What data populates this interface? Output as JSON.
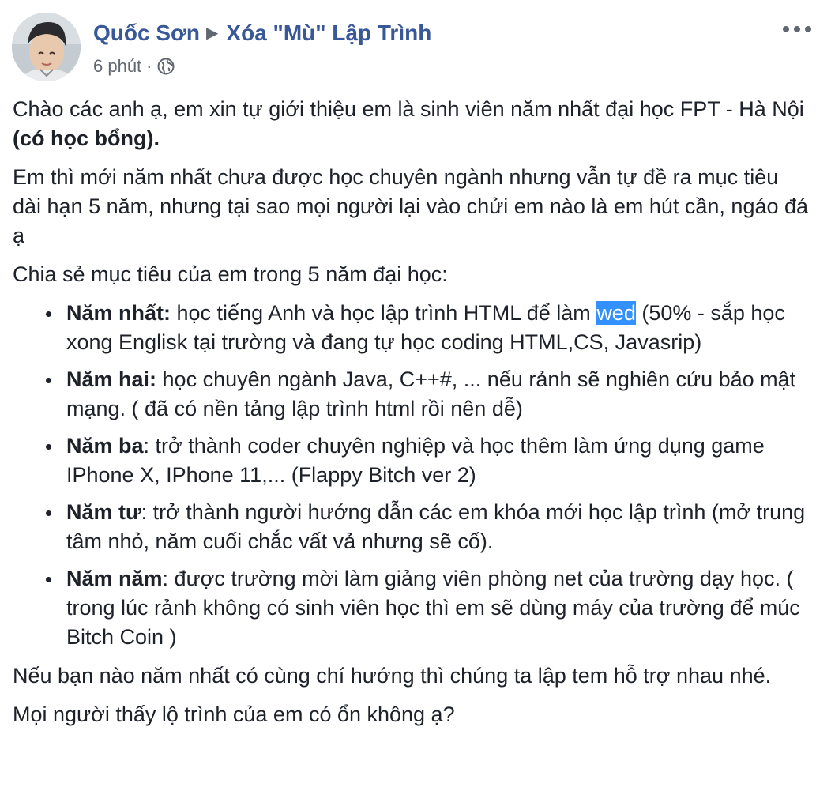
{
  "post": {
    "author": "Quốc Sơn",
    "group": "Xóa \"Mù\" Lập Trình",
    "time": "6 phút",
    "meta_sep": "·",
    "intro_1": "Chào các anh ạ, em xin tự giới thiệu em là sinh viên năm nhất đại học FPT - Hà Nội ",
    "intro_1_bold": "(có học bổng).",
    "intro_2": "Em thì mới năm nhất chưa được học chuyên ngành nhưng vẫn tự đề ra mục tiêu dài hạn 5 năm, nhưng tại sao mọi người lại vào chửi em nào là em hút cần, ngáo đá ạ",
    "list_intro": "Chia sẻ mục tiêu của em trong 5 năm đại học:",
    "goals": [
      {
        "label": "Năm nhất:",
        "text_before": " học tiếng Anh và học lập trình HTML để làm ",
        "highlight": "wed",
        "text_after": " (50% - sắp học xong Englisk tại trường và đang tự học coding HTML,CS, Javasrip)"
      },
      {
        "label": "Năm hai:",
        "text": " học chuyên ngành Java, C++#, ... nếu rảnh sẽ nghiên cứu bảo mật mạng. ( đã có nền tảng lập trình html rồi nên dễ)"
      },
      {
        "label": "Năm ba",
        "text": ": trở thành coder chuyên nghiệp và học thêm làm ứng dụng game IPhone X, IPhone 11,... (Flappy Bitch ver 2)"
      },
      {
        "label": "Năm tư",
        "text": ": trở thành người hướng dẫn các em khóa mới học lập trình (mở trung tâm nhỏ, năm cuối chắc vất vả nhưng sẽ cố)."
      },
      {
        "label": "Năm năm",
        "text": ": được trường mời làm giảng viên phòng net của trường dạy học. ( trong lúc rảnh không có sinh viên học thì em sẽ dùng máy của trường để múc Bitch Coin )"
      }
    ],
    "closing_1": "Nếu bạn nào năm nhất có cùng chí hướng thì chúng ta lập tem hỗ trợ nhau nhé.",
    "closing_2": "Mọi người thấy lộ trình của em có ổn không ạ?"
  },
  "icons": {
    "arrow": "triangle-right-icon",
    "privacy": "globe-icon",
    "more": "more-options-icon"
  },
  "colors": {
    "link": "#385898",
    "text": "#1d2129",
    "meta": "#616770",
    "selection": "#3390ff"
  }
}
